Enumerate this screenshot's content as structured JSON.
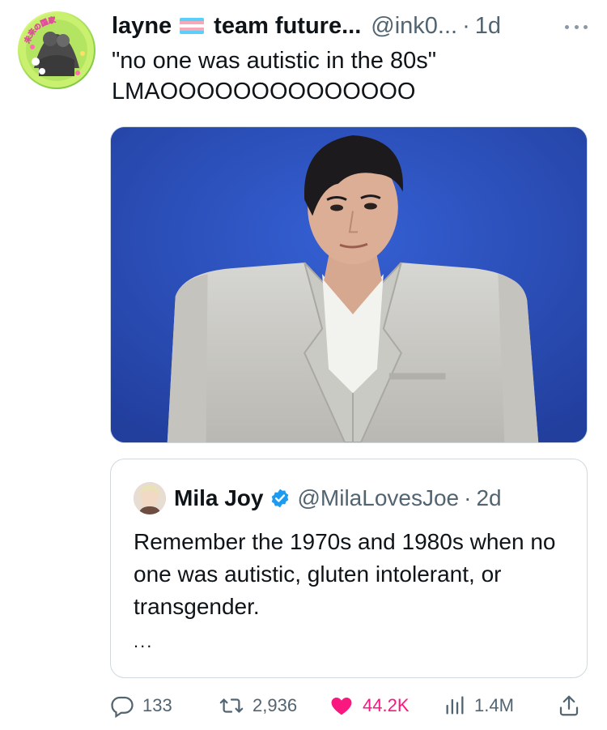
{
  "tweet": {
    "display_name": "layne",
    "name_suffix": "team future...",
    "handle": "@ink0...",
    "separator": "·",
    "time": "1d",
    "text": "\"no one was autistic in the 80s\"\nLMAOOOOOOOOOOOOOO",
    "avatar_text": "未来の国家"
  },
  "quoted_tweet": {
    "display_name": "Mila Joy",
    "handle": "@MilaLovesJoe",
    "separator": "·",
    "time": "2d",
    "text": "Remember the 1970s and 1980s when no one was autistic, gluten intolerant, or transgender.",
    "more": "..."
  },
  "actions": {
    "replies": "133",
    "retweets": "2,936",
    "likes": "44.2K",
    "views": "1.4M"
  },
  "colors": {
    "like_pink": "#f91880",
    "verified_blue": "#1d9bf0",
    "secondary_text": "#536471",
    "photo_background": "#2b4fbd"
  },
  "icons": {
    "reply": "speech-bubble-icon",
    "retweet": "retweet-arrows-icon",
    "like": "heart-icon",
    "views": "bar-chart-icon",
    "share": "share-upload-icon",
    "more": "more-dots-icon",
    "verified": "verified-badge-icon",
    "flag": "transgender-flag-icon"
  }
}
